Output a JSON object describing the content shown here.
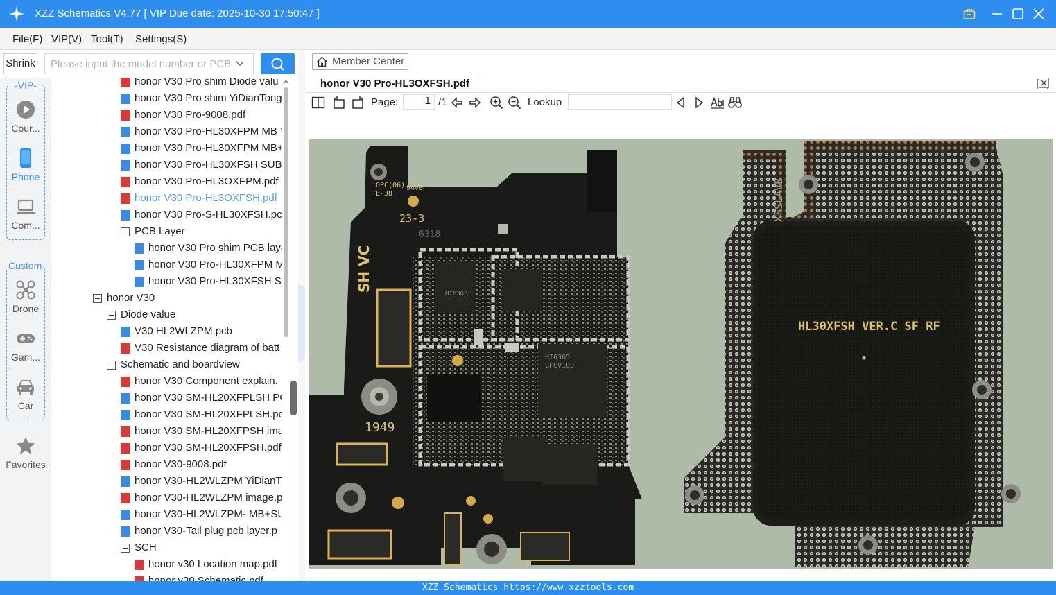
{
  "app": {
    "title": "XZZ Schematics V4.77 [ VIP Due date: 2025-10-30 17:50:47 ]"
  },
  "menu": [
    "File(F)",
    "VIP(V)",
    "Tool(T)",
    "Settings(S)"
  ],
  "search": {
    "shrink_label": "Shrink",
    "placeholder": "Please input the model number or PCB"
  },
  "sidebar": {
    "vip_group_label": "-VIP-",
    "custom_group_label": "Custom",
    "categories": [
      {
        "label": "Cour...",
        "icon": "play-circle-icon",
        "active": false
      },
      {
        "label": "Phone",
        "icon": "phone-icon",
        "active": true
      },
      {
        "label": "Com...",
        "icon": "laptop-icon",
        "active": false
      },
      {
        "label": "Drone",
        "icon": "drone-icon",
        "active": false
      },
      {
        "label": "Gam...",
        "icon": "gamepad-icon",
        "active": false
      },
      {
        "label": "Car",
        "icon": "car-icon",
        "active": false
      },
      {
        "label": "Favorites",
        "icon": "star-icon",
        "active": false
      }
    ]
  },
  "tree": {
    "rows": [
      {
        "text": "honor V30 Pro shim Diode valu",
        "kind": "pdf",
        "level": 2,
        "selected": false
      },
      {
        "text": "honor V30 Pro shim YiDianTong",
        "kind": "pcb",
        "level": 2,
        "selected": false
      },
      {
        "text": "honor V30 Pro-9008.pdf",
        "kind": "pdf",
        "level": 2,
        "selected": false
      },
      {
        "text": "honor V30 Pro-HL30XFPM MB Y",
        "kind": "pcb",
        "level": 2,
        "selected": false
      },
      {
        "text": "honor V30 Pro-HL30XFPM MB+",
        "kind": "pcb",
        "level": 2,
        "selected": false
      },
      {
        "text": "honor V30 Pro-HL30XFSH SUB Y",
        "kind": "pcb",
        "level": 2,
        "selected": false
      },
      {
        "text": "honor V30 Pro-HL3OXFPM.pdf",
        "kind": "pdf",
        "level": 2,
        "selected": false
      },
      {
        "text": "honor V30 Pro-HL3OXFSH.pdf",
        "kind": "pdf",
        "level": 2,
        "selected": true
      },
      {
        "text": "honor V30 Pro-S-HL30XFSH.pcb",
        "kind": "pcb",
        "level": 2,
        "selected": false
      },
      {
        "text": "PCB Layer",
        "kind": "folder",
        "level": 2,
        "selected": false
      },
      {
        "text": "honor V30 Pro shim PCB layer",
        "kind": "pcb",
        "level": 3,
        "selected": false
      },
      {
        "text": "honor V30 Pro-HL30XFPM M",
        "kind": "pcb",
        "level": 3,
        "selected": false
      },
      {
        "text": "honor V30 Pro-HL30XFSH SU",
        "kind": "pcb",
        "level": 3,
        "selected": false
      },
      {
        "text": "honor V30",
        "kind": "folder",
        "level": 0,
        "selected": false
      },
      {
        "text": "Diode value",
        "kind": "folder",
        "level": 1,
        "selected": false
      },
      {
        "text": "V30 HL2WLZPM.pcb",
        "kind": "pcb",
        "level": 2,
        "selected": false
      },
      {
        "text": "V30 Resistance diagram of batt",
        "kind": "pdf",
        "level": 2,
        "selected": false
      },
      {
        "text": "Schematic and boardview",
        "kind": "folder",
        "level": 1,
        "selected": false
      },
      {
        "text": "honor V30 Component explain.",
        "kind": "pdf",
        "level": 2,
        "selected": false
      },
      {
        "text": "honor V30 SM-HL20XFPLSH PCI",
        "kind": "pcb",
        "level": 2,
        "selected": false
      },
      {
        "text": "honor V30 SM-HL20XFPLSH.pcb",
        "kind": "pcb",
        "level": 2,
        "selected": false
      },
      {
        "text": "honor V30 SM-HL20XFPSH ima",
        "kind": "pdf",
        "level": 2,
        "selected": false
      },
      {
        "text": "honor V30 SM-HL20XFPSH.pdf",
        "kind": "pdf",
        "level": 2,
        "selected": false
      },
      {
        "text": "honor V30-9008.pdf",
        "kind": "pdf",
        "level": 2,
        "selected": false
      },
      {
        "text": "honor V30-HL2WLZPM YiDianT",
        "kind": "pcb",
        "level": 2,
        "selected": false
      },
      {
        "text": "honor V30-HL2WLZPM image.p",
        "kind": "pdf",
        "level": 2,
        "selected": false
      },
      {
        "text": "honor V30-HL2WLZPM- MB+SU",
        "kind": "pcb",
        "level": 2,
        "selected": false
      },
      {
        "text": "honor V30-Tail plug pcb layer.p",
        "kind": "pcb",
        "level": 2,
        "selected": false
      },
      {
        "text": "SCH",
        "kind": "folder",
        "level": 2,
        "selected": false
      },
      {
        "text": "honor v30 Location map.pdf",
        "kind": "pdf",
        "level": 3,
        "selected": false
      },
      {
        "text": "honor v30 Schematic.pdf",
        "kind": "pdf",
        "level": 3,
        "selected": false
      }
    ]
  },
  "viewer": {
    "member_center": "Member Center",
    "tab_title": "honor V30 Pro-HL3OXFSH.pdf",
    "page_label": "Page:",
    "page_value": "1",
    "page_total": "/1",
    "lookup_label": "Lookup",
    "board_text": {
      "left_top": "OPC(06)",
      "left_top2": "E-38",
      "left_94": "94V0",
      "left_233": "23-3",
      "left_6318": "6318",
      "left_shvc": "SH VC",
      "left_1949": "1949",
      "chip1": "HI6363",
      "chip2": "HI6365",
      "chip2b": "GFCV100",
      "right_side": "XFSLAVB",
      "right_label": "HL30XFSH VER.C SF RF"
    }
  },
  "status": {
    "text": "XZZ Schematics  https://www.xzztools.com"
  },
  "colors": {
    "accent": "#2e8ef0",
    "selected_text": "#5b9bea",
    "board_bg": "#aebba8",
    "pcb_black": "#1a1a18"
  }
}
